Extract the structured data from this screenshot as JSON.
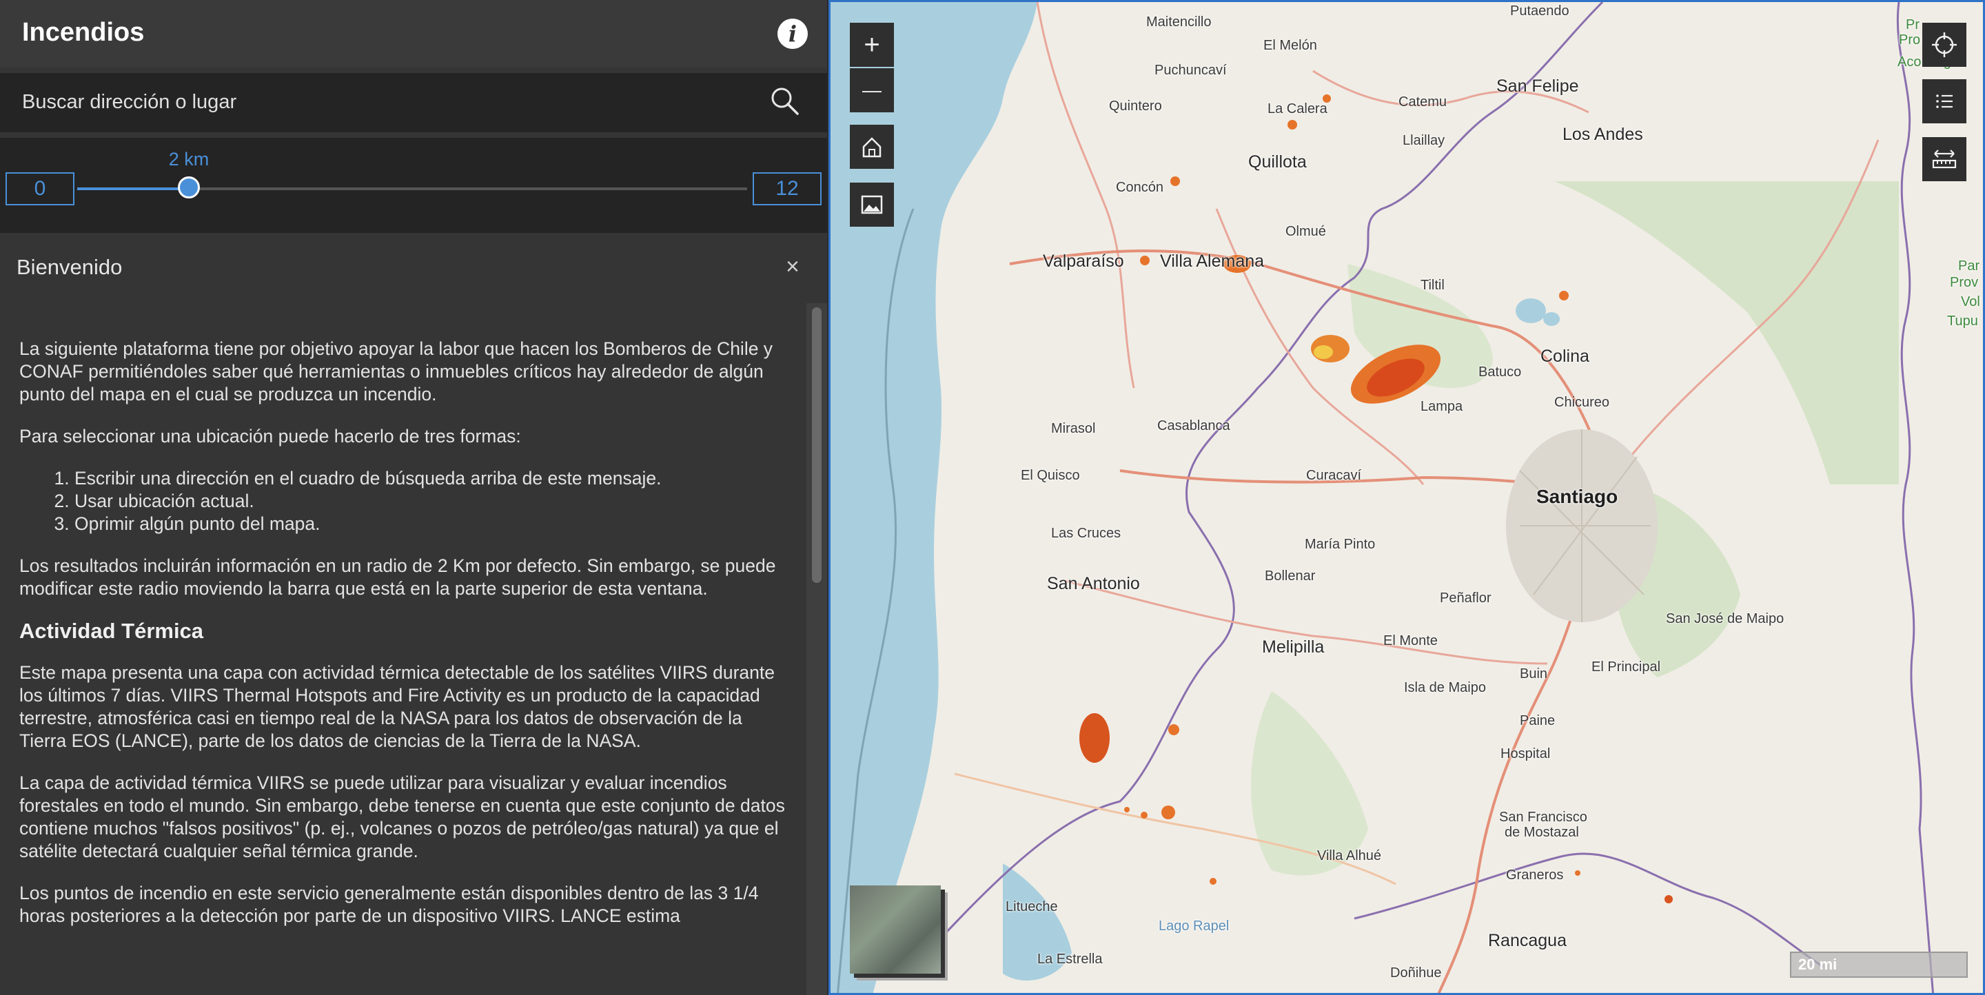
{
  "app": {
    "title": "Incendios"
  },
  "search": {
    "placeholder": "Buscar dirección o lugar"
  },
  "slider": {
    "min": "0",
    "max": "12",
    "value_label": "2 km",
    "value": 2
  },
  "welcome": {
    "title": "Bienvenido",
    "close_label": "×",
    "p1": "La siguiente plataforma tiene por objetivo apoyar la labor que hacen los Bomberos de Chile y CONAF permitiéndoles saber qué herramientas o inmuebles críticos hay alrededor de algún punto del mapa en el cual se produzca un incendio.",
    "p2": "Para seleccionar una ubicación puede hacerlo de tres formas:",
    "steps": [
      "Escribir una dirección en el cuadro de búsqueda arriba de este mensaje.",
      "Usar ubicación actual.",
      "Oprimir algún punto del mapa."
    ],
    "p3": "Los resultados incluirán información en un radio de 2 Km por defecto. Sin embargo, se puede modificar este radio moviendo la barra que está en la parte superior de esta ventana.",
    "h_thermal": "Actividad Térmica",
    "p4": "Este mapa presenta una capa con actividad térmica detectable de los satélites VIIRS durante los últimos 7 días. VIIRS Thermal Hotspots and Fire Activity es un producto de la capacidad terrestre, atmosférica casi en tiempo real de la NASA para los datos de observación de la Tierra EOS (LANCE), parte de los datos de ciencias de la Tierra de la NASA.",
    "p5": "La capa de actividad térmica VIIRS se puede utilizar para visualizar y evaluar incendios forestales en todo el mundo. Sin embargo, debe tenerse en cuenta que este conjunto de datos contiene muchos \"falsos positivos\" (p. ej., volcanes o pozos de petróleo/gas natural) ya que el satélite detectará cualquier señal térmica grande.",
    "p6": "Los puntos de incendio en este servicio generalmente están disponibles dentro de las 3 1/4 horas posteriores a la detección por parte de un dispositivo VIIRS. LANCE estima"
  },
  "map": {
    "scale_label": "20 mi",
    "tools": {
      "zoom_in": "+",
      "zoom_out": "—"
    },
    "labels": {
      "maitencillo": "Maitencillo",
      "putaendo": "Putaendo",
      "el_melon": "El Melón",
      "puchuncavi": "Puchuncaví",
      "catemu": "Catemu",
      "san_felipe": "San Felipe",
      "quintero": "Quintero",
      "la_calera": "La Calera",
      "llaillay": "Llaillay",
      "los_andes": "Los Andes",
      "quillota": "Quillota",
      "concon": "Concón",
      "olmue": "Olmué",
      "valparaiso": "Valparaíso",
      "villa_alemana": "Villa Alemana",
      "tiltil": "Tiltil",
      "colina": "Colina",
      "batuco": "Batuco",
      "lampa": "Lampa",
      "chicureo": "Chicureo",
      "mirasol": "Mirasol",
      "casablanca": "Casablanca",
      "el_quisco": "El Quisco",
      "curacavi": "Curacaví",
      "santiago": "Santiago",
      "las_cruces": "Las Cruces",
      "maria_pinto": "María Pinto",
      "bollenar": "Bollenar",
      "san_antonio": "San Antonio",
      "penaflor": "Peñaflor",
      "san_jose_maipo": "San José de Maipo",
      "melipilla": "Melipilla",
      "el_monte": "El Monte",
      "buin": "Buin",
      "el_principal": "El Principal",
      "isla_maipo": "Isla de Maipo",
      "paine": "Paine",
      "hospital": "Hospital",
      "san_francisco_mostazal": "San Francisco",
      "de_mostazal": "de Mostazal",
      "villa_alhue": "Villa Alhué",
      "graneros": "Graneros",
      "litueche": "Litueche",
      "lago_rapel": "Lago Rapel",
      "rancagua": "Rancagua",
      "la_estrella": "La Estrella",
      "donihue": "Doñihue",
      "pr_left": "Pr",
      "pro_left": "Pro",
      "aconcagua": "Aconcagua",
      "par": "Par",
      "prov": "Prov",
      "vol": "Vol",
      "tupu": "Tupu"
    }
  }
}
